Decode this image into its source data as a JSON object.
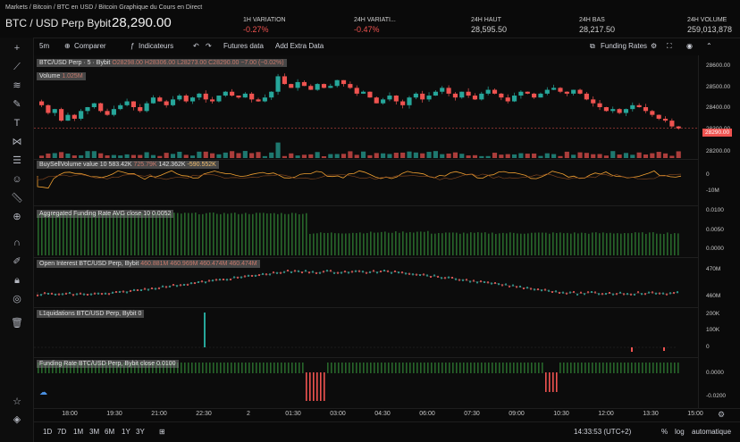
{
  "breadcrumb": [
    "Markets",
    "/",
    "Bitcoin",
    "/",
    "BTC en USD",
    "/",
    "Bitcoin Graphique du Cours en Direct"
  ],
  "header": {
    "title": "BTC / USD Perp Bybit",
    "price": "28,290.00",
    "stats": [
      {
        "label": "1H VARIATION",
        "value": "-0.27%",
        "negative": true
      },
      {
        "label": "24H VARIATI...",
        "value": "-0.47%",
        "negative": true
      },
      {
        "label": "24H HAUT",
        "value": "28,595.50",
        "negative": false
      },
      {
        "label": "24H BAS",
        "value": "28,217.50",
        "negative": false
      },
      {
        "label": "24H VOLUME",
        "value": "259,013,878",
        "negative": false
      }
    ]
  },
  "toolbar": {
    "interval": "5m",
    "compare": "Comparer",
    "indicators": "Indicateurs",
    "futures": "Futures data",
    "extra": "Add Extra Data",
    "funding": "Funding Rates"
  },
  "legends": {
    "main": "BTC/USD Perp · 5 · Bybit",
    "ohlc": "O28298.00 H28306.00 L28273.00 C28290.00 −7.00 (−0.02%)",
    "volume": "Volume",
    "volume_val": "1.025M",
    "bsv": "BuySellVolume value 10",
    "bsv_vals": "583.42K",
    "bsv_dim": "725.79K",
    "bsv_vals2": "142.362K",
    "bsv_neg": "-590.552K",
    "agg_funding": "Aggregated Funding Rate AVG close 10",
    "agg_val": "0.0052",
    "oi": "Open Interest BTC/USD Perp, Bybit",
    "oi_dim": "460.881M 460.969M 460.474M 460.474M",
    "liq": "L1quidations BTC/USD Perp, Bybit",
    "liq_val": "0",
    "fr": "Funding Rate BTC/USD Perp, Bybit close",
    "fr_val": "0.0100"
  },
  "yaxis": {
    "price": [
      "28600.00",
      "28500.00",
      "28400.00",
      "28300.00",
      "28200.00"
    ],
    "last_price": "28290.00",
    "bsv": [
      "0",
      "-10M"
    ],
    "agg": [
      "0.0100",
      "0.0050",
      "0.0000"
    ],
    "oi": [
      "470M",
      "460M"
    ],
    "liq": [
      "200K",
      "100K",
      "0"
    ],
    "fr": [
      "0.0000",
      "-0.0200"
    ]
  },
  "xaxis": [
    "18:00",
    "19:30",
    "21:00",
    "22:30",
    "2",
    "01:30",
    "03:00",
    "04:30",
    "06:00",
    "07:30",
    "09:00",
    "10:30",
    "12:00",
    "13:30",
    "15:00"
  ],
  "bottom": {
    "ranges": [
      "1D",
      "7D",
      "1M",
      "3M",
      "6M",
      "1Y",
      "3Y"
    ],
    "time": "14:33:53 (UTC+2)",
    "pct": "%",
    "log": "log",
    "auto": "automatique"
  },
  "colors": {
    "up": "#26a69a",
    "down": "#ef5350",
    "accent": "#f0a030",
    "funding": "#2e7d32"
  },
  "chart_data": {
    "type": "candlestick",
    "title": "BTC/USD Perp · 5 · Bybit",
    "ylim": [
      28150,
      28650
    ],
    "close": [
      28410,
      28370,
      28390,
      28330,
      28360,
      28340,
      28380,
      28400,
      28420,
      28380,
      28360,
      28390,
      28410,
      28430,
      28400,
      28380,
      28420,
      28450,
      28430,
      28410,
      28440,
      28460,
      28430,
      28450,
      28470,
      28440,
      28430,
      28460,
      28480,
      28460,
      28450,
      28470,
      28440,
      28430,
      28450,
      28480,
      28560,
      28520,
      28500,
      28530,
      28510,
      28490,
      28520,
      28500,
      28510,
      28540,
      28520,
      28500,
      28470,
      28480,
      28450,
      28420,
      28440,
      28460,
      28430,
      28410,
      28450,
      28470,
      28440,
      28460,
      28480,
      28500,
      28470,
      28450,
      28480,
      28460,
      28440,
      28470,
      28490,
      28470,
      28450,
      28430,
      28460,
      28480,
      28470,
      28450,
      28470,
      28490,
      28500,
      28480,
      28470,
      28490,
      28470,
      28440,
      28420,
      28400,
      28380,
      28390,
      28370,
      28390,
      28410,
      28400,
      28380,
      28360,
      28340,
      28330,
      28300,
      28290
    ]
  }
}
